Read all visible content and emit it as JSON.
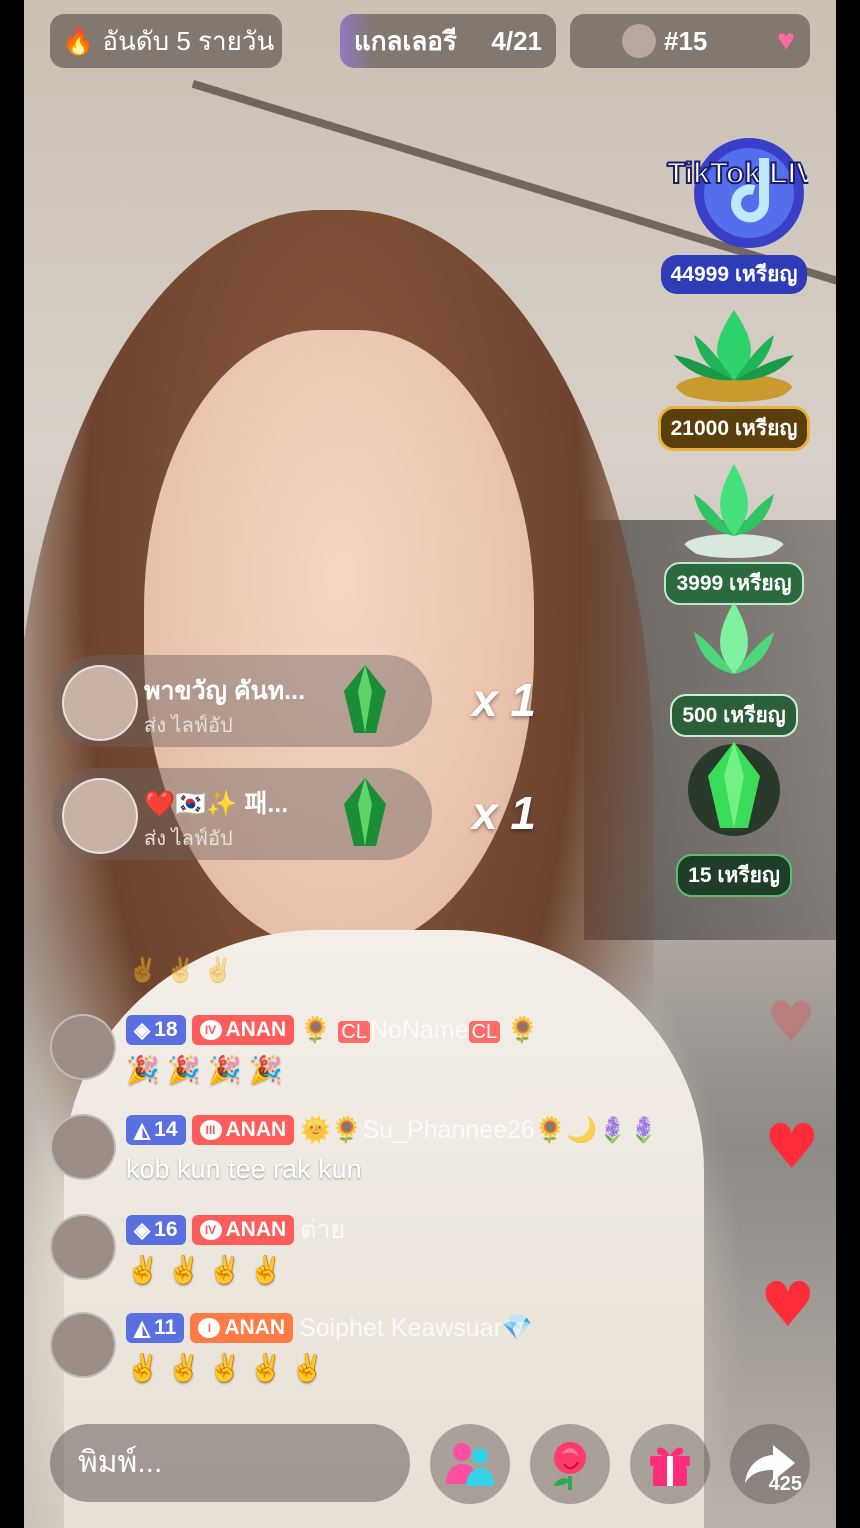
{
  "top_bar": {
    "rank_label": "อันดับ 5 รายวัน",
    "gallery_label": "แกลเลอรี",
    "gallery_count": "4/21",
    "viewer_rank": "#15"
  },
  "gift_menu": [
    {
      "price": "44999 เหรียญ",
      "icon": "tiktok-live-icon",
      "art_text": "TikTok LIVE"
    },
    {
      "price": "21000 เหรียญ",
      "icon": "green-lotus-gold-icon"
    },
    {
      "price": "3999 เหรียญ",
      "icon": "green-lotus-icon"
    },
    {
      "price": "500 เหรียญ",
      "icon": "green-lotus-small-icon"
    },
    {
      "price": "15 เหรียญ",
      "icon": "green-gem-icon"
    }
  ],
  "gift_notifications": [
    {
      "name": "พาขวัญ คันท...",
      "action": "ส่ง ไลฟ์อัป",
      "count": "x 1"
    },
    {
      "name": "❤️🇰🇷✨ 패...",
      "action": "ส่ง ไลฟ์อัป",
      "count": "x 1"
    }
  ],
  "chat_top_emojis": "✌️ ✌️ ✌️",
  "chat": [
    {
      "level": "18",
      "fan_level": "IV",
      "fan_name": "ANAN",
      "username_prefix": "🌻",
      "username_badge": "CL",
      "username": "NoName",
      "username_suffix": "🌻",
      "message": "🎉 🎉 🎉 🎉"
    },
    {
      "level": "14",
      "fan_level": "III",
      "fan_name": "ANAN",
      "username_prefix": "🌞🌻",
      "username": "Su_Phannee26",
      "username_suffix": "🌻🌙🪻🪻",
      "message": "kob kun tee rak kun"
    },
    {
      "level": "16",
      "fan_level": "IV",
      "fan_name": "ANAN",
      "username": "ต่าย",
      "message": "✌️ ✌️ ✌️ ✌️"
    },
    {
      "level": "11",
      "fan_level": "I",
      "fan_name": "ANAN",
      "username": "Soiphet Keawsuar💎",
      "message": "✌️ ✌️ ✌️ ✌️ ✌️"
    }
  ],
  "bottom_bar": {
    "input_placeholder": "พิมพ์...",
    "share_count": "425"
  },
  "colors": {
    "level_badge": "#5a6fe0",
    "fan_badge": "#ff5c5c",
    "heart": "#ff2d3a"
  }
}
